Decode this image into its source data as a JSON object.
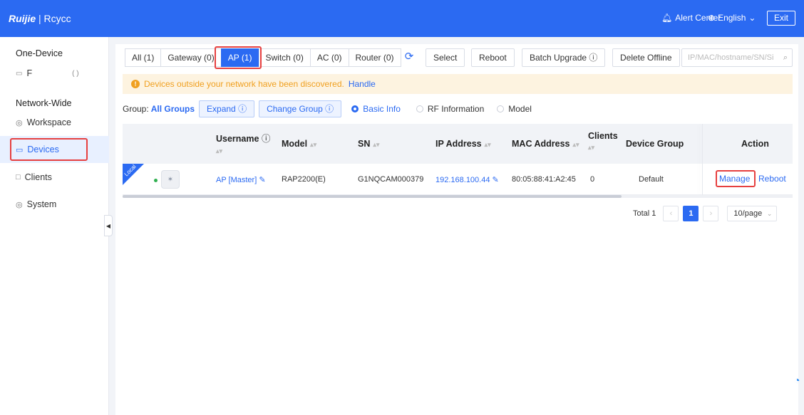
{
  "topbar": {
    "logo_brand": "Ruijie",
    "logo_sep": "|",
    "logo_sub": "Rcycc",
    "alert_center": "Alert Center",
    "language": "English",
    "exit": "Exit",
    "alert_icon": "bell-icon",
    "language_icon": "globe-icon"
  },
  "sidebar": {
    "section_one": "One-Device",
    "device_placeholder": "F",
    "device_suffix": "( )",
    "section_network": "Network-Wide",
    "items": [
      {
        "label": "Workspace",
        "icon": "workspace-icon"
      },
      {
        "label": "Devices",
        "icon": "devices-icon",
        "active": true
      },
      {
        "label": "Clients",
        "icon": "clients-icon"
      },
      {
        "label": "System",
        "icon": "system-icon"
      }
    ]
  },
  "toolbar": {
    "tabs": [
      "All (1)",
      "Gateway (0)",
      "AP (1)",
      "Switch (0)",
      "AC (0)",
      "Router (0)"
    ],
    "active_tab": "AP (1)",
    "select": "Select",
    "reboot": "Reboot",
    "batch_upgrade": "Batch Upgrade",
    "delete_offline": "Delete Offline",
    "search_placeholder": "IP/MAC/hostname/SN/Si"
  },
  "notice": {
    "text": "Devices outside your network have been discovered.",
    "link": "Handle"
  },
  "group": {
    "label": "Group:",
    "value": "All Groups",
    "expand": "Expand",
    "change_group": "Change Group",
    "views": [
      "Basic Info",
      "RF Information",
      "Model"
    ],
    "active_view": "Basic Info"
  },
  "table": {
    "headers": {
      "username": "Username",
      "model": "Model",
      "sn": "SN",
      "ip": "IP Address",
      "mac": "MAC Address",
      "clients": "Clients",
      "group": "Device Group",
      "action": "Action"
    },
    "rows": [
      {
        "tag": "Local",
        "username": "AP [Master]",
        "model": "RAP2200(E)",
        "sn": "G1NQCAM000379",
        "ip": "192.168.100.44",
        "mac": "80:05:88:41:A2:45",
        "clients": "0",
        "group": "Default",
        "manage": "Manage",
        "reboot": "Reboot"
      }
    ]
  },
  "pager": {
    "total": "Total 1",
    "current": "1",
    "page_size": "10/page"
  },
  "colors": {
    "primary": "#2b6af2",
    "highlight": "#e64040",
    "warning": "#f0a020"
  }
}
